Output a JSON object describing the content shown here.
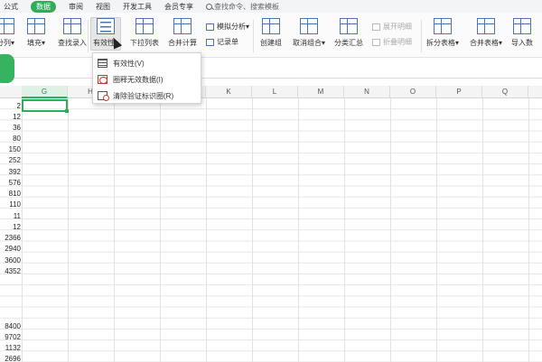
{
  "menubar": {
    "tabs": [
      "公式",
      "数据",
      "审阅",
      "视图",
      "开发工具",
      "会员专享"
    ],
    "active": "数据",
    "search_text": "查找命令、搜索模板"
  },
  "ribbon": {
    "buttons": {
      "split": "分列",
      "fill": "填充",
      "find_entry": "查找录入",
      "validity": "有效性",
      "dropdown_list": "下拉列表",
      "consolidate": "合并计算",
      "simulate": "模拟分析",
      "record_sheet": "记录单",
      "create_group": "创建组",
      "ungroup": "取消组合",
      "subtotal": "分类汇总",
      "expand_detail": "展开明细",
      "collapse_detail": "折叠明细",
      "split_table": "拆分表格",
      "merge_table": "合并表格",
      "import": "导入数"
    }
  },
  "dropdown": {
    "items": [
      "有效性(V)",
      "圈释无效数据(I)",
      "清除验证标识圈(R)"
    ]
  },
  "sheet": {
    "columns": [
      "G",
      "H",
      "I",
      "J",
      "K",
      "L",
      "M",
      "N",
      "O",
      "P",
      "Q"
    ],
    "selected_column": "G",
    "values": [
      {
        "row": 0,
        "v": "2"
      },
      {
        "row": 1,
        "v": "12"
      },
      {
        "row": 2,
        "v": "36"
      },
      {
        "row": 3,
        "v": "80"
      },
      {
        "row": 4,
        "v": "150"
      },
      {
        "row": 5,
        "v": "252"
      },
      {
        "row": 6,
        "v": "392"
      },
      {
        "row": 7,
        "v": "576"
      },
      {
        "row": 8,
        "v": "810"
      },
      {
        "row": 9,
        "v": "110"
      },
      {
        "row": 10,
        "v": "11"
      },
      {
        "row": 11,
        "v": "12"
      },
      {
        "row": 12,
        "v": "2366"
      },
      {
        "row": 13,
        "v": "2940"
      },
      {
        "row": 14,
        "v": "3600"
      },
      {
        "row": 15,
        "v": "4352"
      },
      {
        "row": 20,
        "v": "8400"
      },
      {
        "row": 21,
        "v": "9702"
      },
      {
        "row": 22,
        "v": "1132"
      },
      {
        "row": 23,
        "v": "2696"
      }
    ]
  }
}
